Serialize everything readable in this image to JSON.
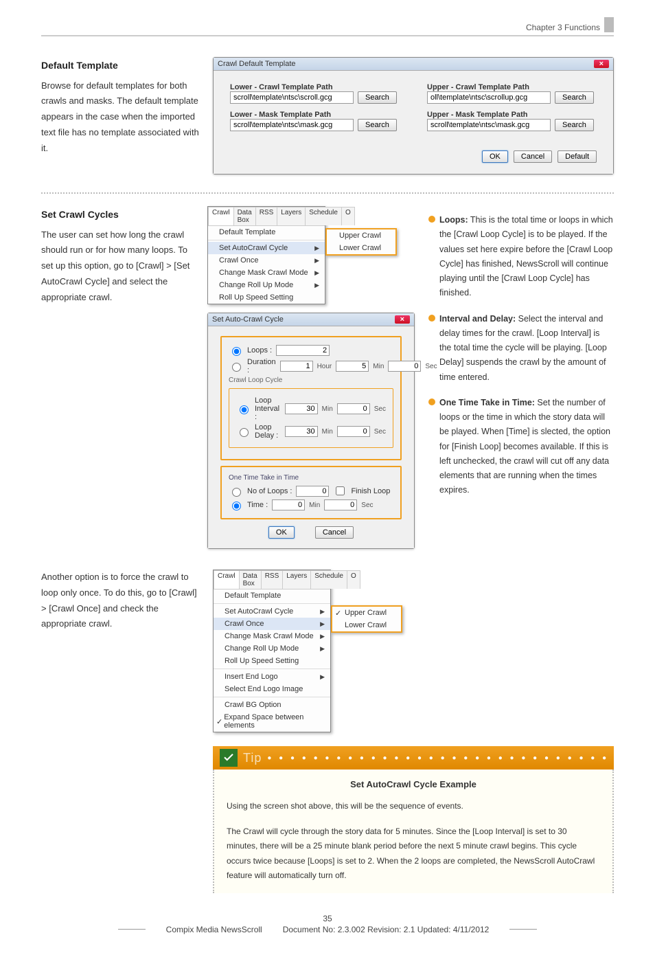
{
  "header": {
    "chapter": "Chapter 3 Functions"
  },
  "sec1": {
    "title": "Default Template",
    "body": "Browse for default templates for both crawls and masks. The default template appears in the case when the imported text file has no template associated with it."
  },
  "dlg1": {
    "title": "Crawl Default Template",
    "l1": "Lower - Crawl Template Path",
    "v1": "scroll\\template\\ntsc\\scroll.gcg",
    "l2": "Lower - Mask Template Path",
    "v2": "scroll\\template\\ntsc\\mask.gcg",
    "r1": "Upper - Crawl Template Path",
    "rv1": "oll\\template\\ntsc\\scrollup.gcg",
    "r2": "Upper - Mask Template Path",
    "rv2": "scroll\\template\\ntsc\\mask.gcg",
    "search": "Search",
    "ok": "OK",
    "cancel": "Cancel",
    "default": "Default"
  },
  "sec2": {
    "title": "Set Crawl Cycles",
    "body": "The user can set how long the crawl should run or for how many loops. To set up this option, go to [Crawl] > [Set AutoCrawl Cycle] and select the appropriate crawl."
  },
  "menu1": {
    "tabs": [
      "Crawl",
      "Data Box",
      "RSS",
      "Layers",
      "Schedule",
      "O"
    ],
    "items": [
      "Default Template",
      "Set AutoCrawl Cycle",
      "Crawl Once",
      "Change Mask Crawl Mode",
      "Change Roll Up Mode",
      "Roll Up Speed Setting"
    ],
    "sub": [
      "Upper Crawl",
      "Lower Crawl"
    ]
  },
  "dlg2": {
    "title": "Set Auto-Crawl Cycle",
    "loops": "Loops :",
    "loops_v": "2",
    "duration": "Duration :",
    "d_h": "1",
    "d_m": "5",
    "d_s": "0",
    "hour": "Hour",
    "min": "Min",
    "sec": "Sec",
    "clc": "Crawl Loop Cycle",
    "li": "Loop Interval :",
    "li_m": "30",
    "li_s": "0",
    "ld": "Loop Delay :",
    "ld_m": "30",
    "ld_s": "0",
    "ott": "One Time Take in Time",
    "nol": "No of Loops :",
    "nol_v": "0",
    "fl": "Finish Loop",
    "time": "Time :",
    "t_m": "0",
    "t_s": "0",
    "ok": "OK",
    "cancel": "Cancel"
  },
  "callouts": {
    "c1b": "Loops:",
    "c1": " This is the total time or loops in which the [Crawl Loop Cycle] is to be played. If the values set here expire before the [Crawl Loop Cycle] has finished, NewsScroll will continue playing until the [Crawl Loop Cycle] has finished.",
    "c2b": "Interval and Delay:",
    "c2": " Select the interval and delay times for the crawl. [Loop Interval] is the total time the cycle will be playing. [Loop Delay] suspends the crawl by the amount of time entered.",
    "c3b": "One Time Take in Time:",
    "c3": " Set the number of loops or the time in which the story data will be played. When [Time] is slected, the option for [Finish Loop] becomes available. If this is left unchecked, the crawl will cut off any data elements that are running when the times expires."
  },
  "sec3": {
    "body": "Another option is to force the crawl to loop only once. To do this, go to [Crawl] > [Crawl Once] and check the appropriate crawl."
  },
  "menu2": {
    "items": [
      "Default Template",
      "Set AutoCrawl Cycle",
      "Crawl Once",
      "Change Mask Crawl Mode",
      "Change Roll Up Mode",
      "Roll Up Speed Setting",
      "Insert End Logo",
      "Select End Logo Image",
      "Crawl BG Option",
      "Expand Space between elements"
    ],
    "sub": [
      "Upper Crawl",
      "Lower Crawl"
    ]
  },
  "tip": {
    "label": "Tip",
    "title": "Set AutoCrawl Cycle Example",
    "p1": "Using the screen shot above, this will be the sequence of events.",
    "p2": "The Crawl will cycle through the story data for 5 minutes. Since the [Loop Interval] is set to 30 minutes, there will be a 25 minute blank period before the next 5 minute crawl begins. This cycle occurs twice because [Loops] is set to 2. When the 2 loops are completed, the NewsScroll AutoCrawl feature will automatically turn off."
  },
  "footer": {
    "page": "35",
    "product": "Compix Media NewsScroll",
    "doc": "Document No: 2.3.002 Revision: 2.1 Updated: 4/11/2012"
  }
}
